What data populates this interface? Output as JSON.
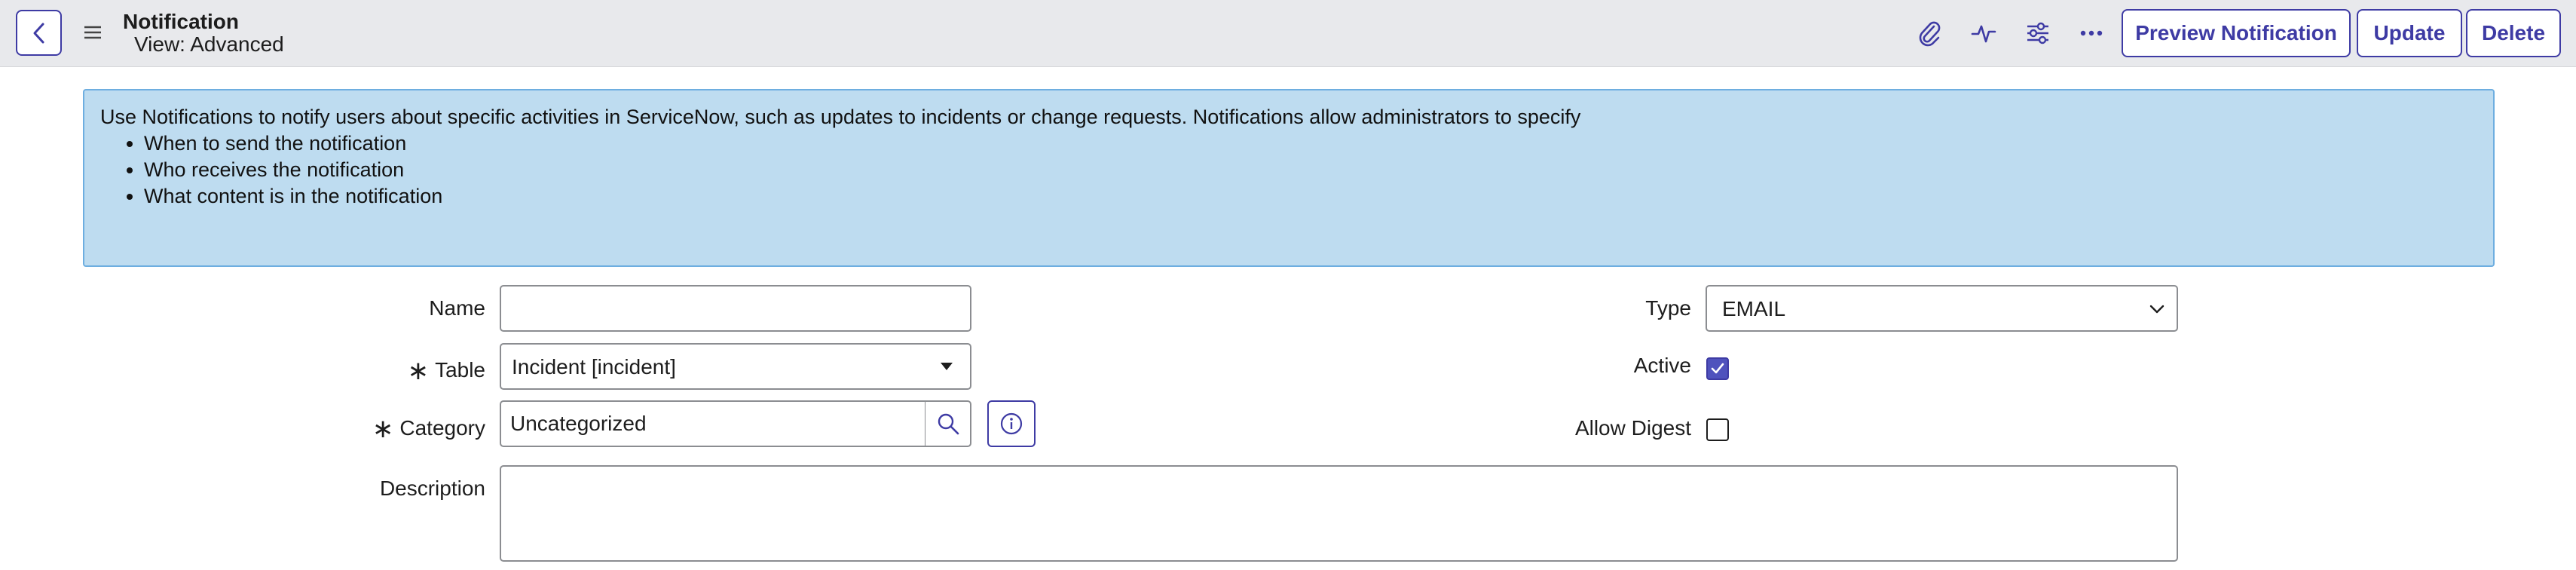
{
  "header": {
    "title": "Notification",
    "subtitle": "View: Advanced",
    "icons": [
      "back-icon",
      "menu-icon",
      "attachment-icon",
      "activity-icon",
      "settings-icon",
      "more-icon"
    ],
    "buttons": {
      "preview": "Preview Notification",
      "update": "Update",
      "delete": "Delete"
    }
  },
  "info": {
    "intro": "Use Notifications to notify users about specific activities in ServiceNow, such as updates to incidents or change requests. Notifications allow administrators to specify",
    "bullets": [
      "When to send the notification",
      "Who receives the notification",
      "What content is in the notification"
    ]
  },
  "form": {
    "name": {
      "label": "Name",
      "value": ""
    },
    "table": {
      "label": "Table",
      "required": true,
      "value": "Incident [incident]"
    },
    "category": {
      "label": "Category",
      "required": true,
      "value": "Uncategorized"
    },
    "description": {
      "label": "Description",
      "value": ""
    },
    "type": {
      "label": "Type",
      "value": "EMAIL"
    },
    "active": {
      "label": "Active",
      "checked": true
    },
    "allow_digest": {
      "label": "Allow Digest",
      "checked": false
    },
    "required_marker": "∗"
  },
  "colors": {
    "accent": "#3e3ba4",
    "info_bg": "#bedcf0",
    "info_border": "#6eaee0",
    "header_bg": "#e8e9ec",
    "field_border": "#8b8d91"
  }
}
